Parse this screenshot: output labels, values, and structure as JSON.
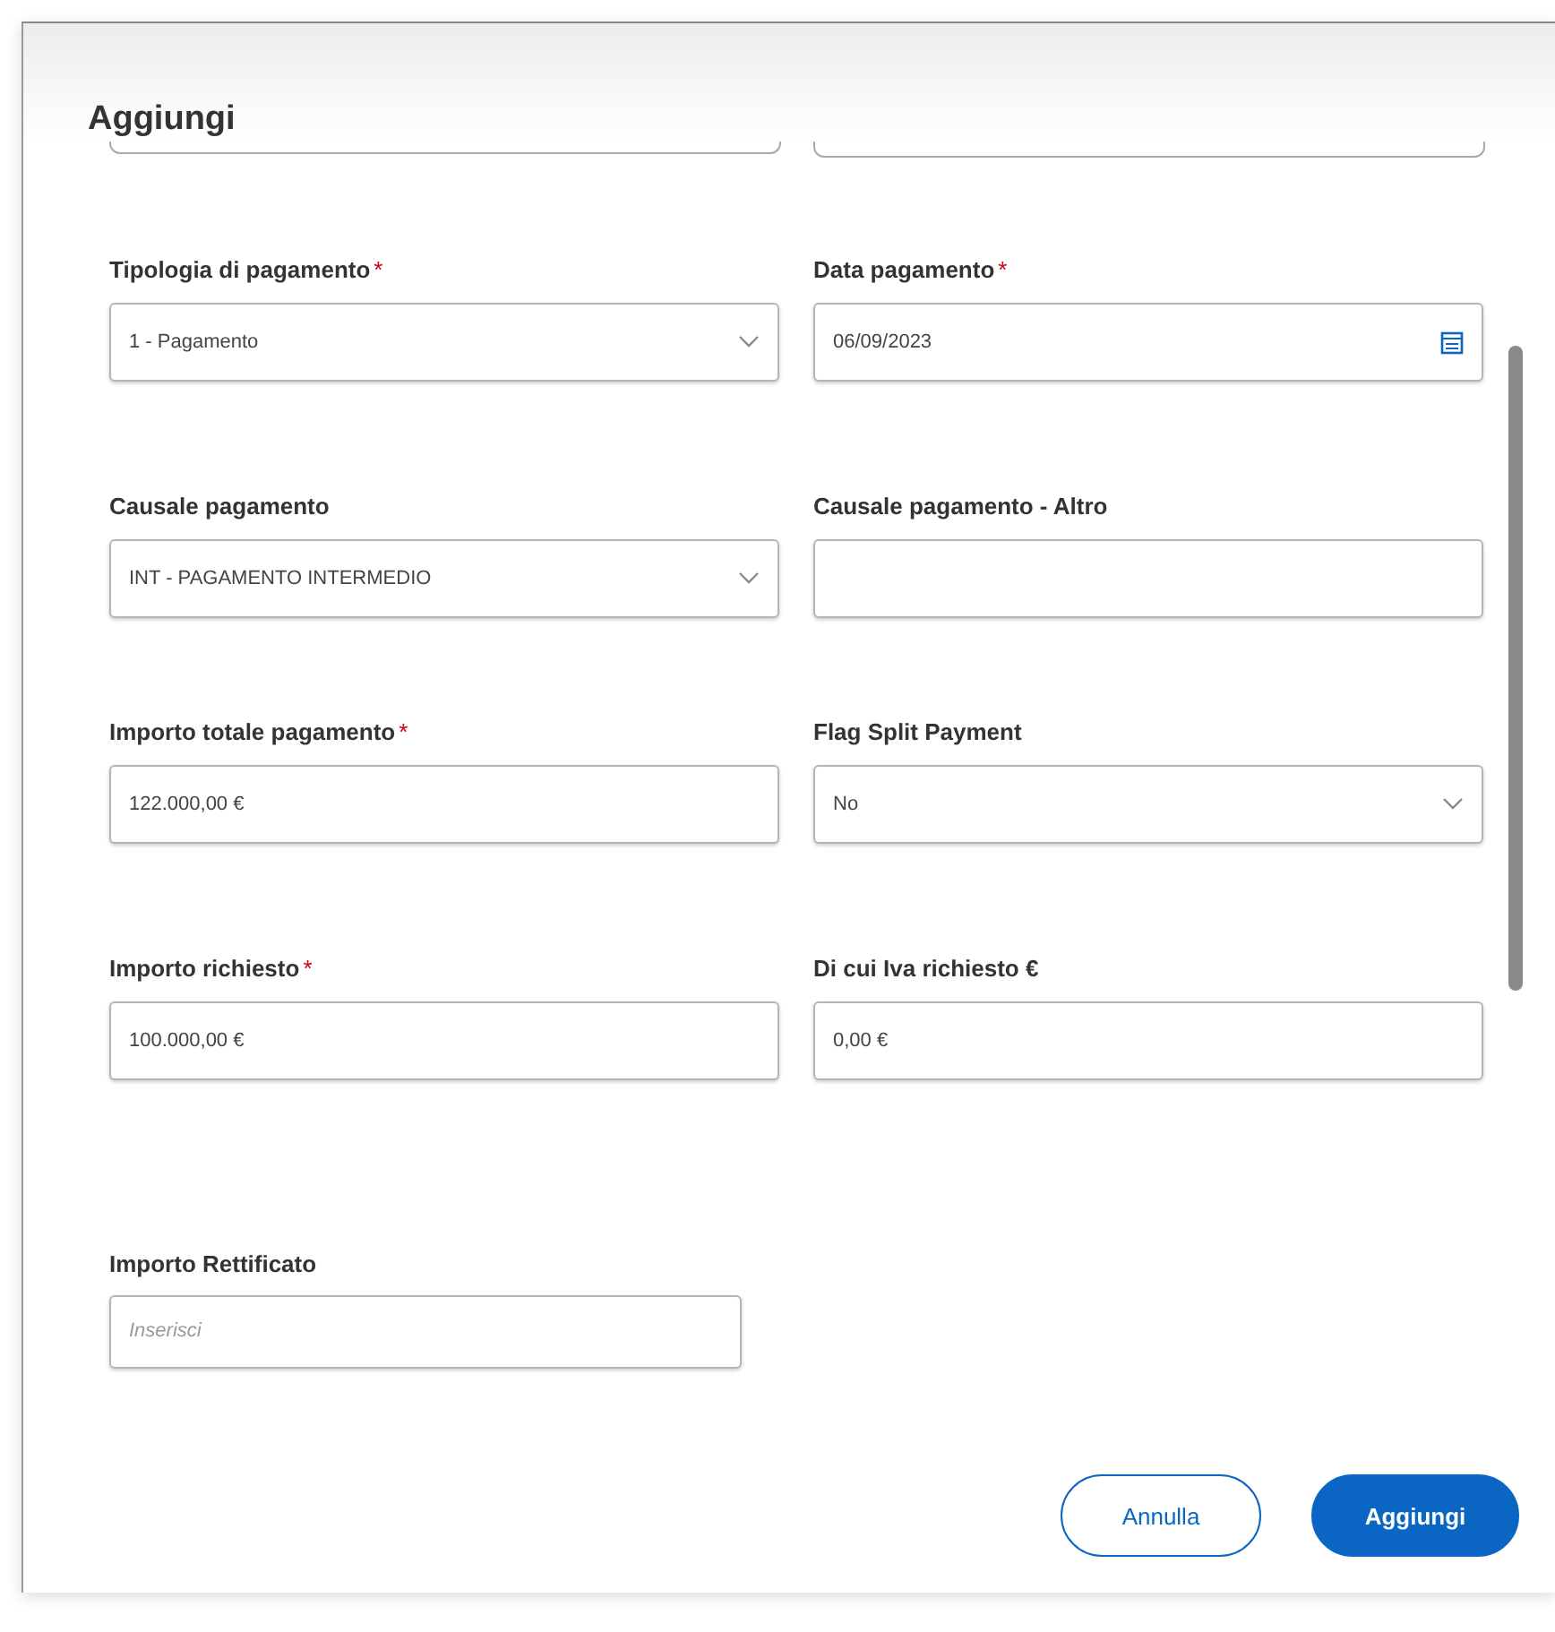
{
  "dialog": {
    "title": "Aggiungi"
  },
  "fields": [
    {
      "label": "Tipologia di pagamento",
      "required_mark": "*",
      "kind": "select",
      "value": "1 - Pagamento"
    },
    {
      "label": "Data pagamento",
      "required_mark": "*",
      "kind": "date",
      "value": "06/09/2023"
    },
    {
      "label": "Causale pagamento",
      "kind": "select",
      "value": "INT - PAGAMENTO INTERMEDIO"
    },
    {
      "label": "Causale pagamento - Altro",
      "kind": "text"
    },
    {
      "label": "Importo totale pagamento",
      "required_mark": "*",
      "kind": "text",
      "value": "122.000,00 €"
    },
    {
      "label": "Flag Split Payment",
      "kind": "select",
      "value": "No"
    },
    {
      "label": "Importo richiesto",
      "required_mark": "*",
      "kind": "text",
      "value": "100.000,00 €"
    },
    {
      "label": "Di cui Iva richiesto €",
      "kind": "text",
      "value": "0,00 €"
    },
    {
      "label": "Importo Rettificato",
      "kind": "text",
      "placeholder": "Inserisci"
    }
  ],
  "buttons": [
    {
      "label": "Annulla",
      "kind": "secondary"
    },
    {
      "label": "Aggiungi",
      "kind": "primary"
    }
  ]
}
